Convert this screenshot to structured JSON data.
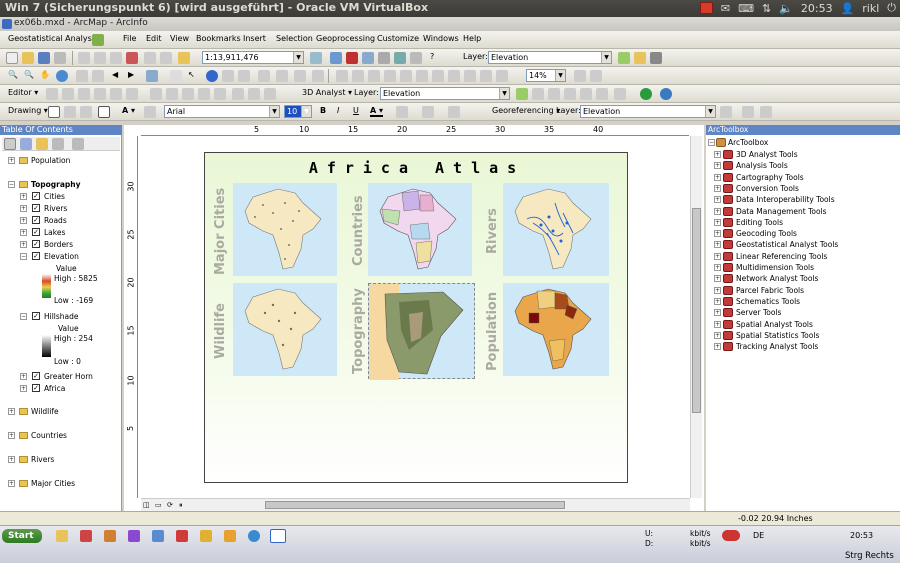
{
  "os_bar": {
    "title": "Win 7 (Sicherungspunkt 6) [wird ausgeführt] - Oracle VM VirtualBox",
    "time": "20:53",
    "user": "rikl"
  },
  "app": {
    "title": "ex06b.mxd - ArcMap - ArcInfo"
  },
  "menu": {
    "geostat": "Geostatistical Analyst ▾",
    "items": [
      "File",
      "Edit",
      "View",
      "Bookmarks",
      "Insert",
      "Selection",
      "Geoprocessing",
      "Customize",
      "Windows",
      "Help"
    ]
  },
  "toolbar1": {
    "scale": "1:13,911,476",
    "layer_label": "Layer:",
    "layer_value": "Elevation"
  },
  "toolbar2": {
    "zoom": "14%"
  },
  "toolbar3": {
    "editor": "Editor ▾",
    "analyst": "3D Analyst ▾",
    "layer_label": "Layer:",
    "layer_value": "Elevation"
  },
  "toolbar4": {
    "drawing": "Drawing ▾",
    "font": "Arial",
    "size": "10",
    "bold": "B",
    "italic": "I",
    "underline": "U",
    "georef": "Georeferencing ▾",
    "layer_label": "Layer:",
    "layer_value": "Elevation"
  },
  "toc": {
    "header": "Table Of Contents",
    "population": "Population",
    "topography": "Topography",
    "layers": [
      "Cities",
      "Rivers",
      "Roads",
      "Lakes",
      "Borders",
      "Elevation"
    ],
    "elev_value": "Value",
    "elev_high": "High : 5825",
    "elev_low": "Low : -169",
    "hillshade": "Hillshade",
    "hs_value": "Value",
    "hs_high": "High : 254",
    "hs_low": "Low : 0",
    "greater_horn": "Greater Horn",
    "africa": "Africa",
    "frames": [
      "Wildlife",
      "Countries",
      "Rivers",
      "Major Cities"
    ]
  },
  "map": {
    "title": "Africa  Atlas",
    "panels": [
      "Major Cities",
      "Countries",
      "Rivers",
      "Wildlife",
      "Topography",
      "Population"
    ],
    "ruler_top": [
      "5",
      "10",
      "15",
      "20",
      "25",
      "30",
      "35",
      "40"
    ],
    "ruler_left": [
      "30",
      "25",
      "20",
      "15",
      "10",
      "5"
    ]
  },
  "toolbox": {
    "header": "ArcToolbox",
    "root": "ArcToolbox",
    "items": [
      "3D Analyst Tools",
      "Analysis Tools",
      "Cartography Tools",
      "Conversion Tools",
      "Data Interoperability Tools",
      "Data Management Tools",
      "Editing Tools",
      "Geocoding Tools",
      "Geostatistical Analyst Tools",
      "Linear Referencing Tools",
      "Multidimension Tools",
      "Network Analyst Tools",
      "Parcel Fabric Tools",
      "Schematics Tools",
      "Server Tools",
      "Spatial Analyst Tools",
      "Spatial Statistics Tools",
      "Tracking Analyst Tools"
    ]
  },
  "status": {
    "coords": "-0.02  20.94 Inches"
  },
  "taskbar": {
    "start": "Start",
    "net_up": "U:",
    "net_down": "D:",
    "kbits1": "kbit/s",
    "kbits2": "kbit/s",
    "lang": "DE",
    "time": "20:53",
    "strg": "Strg Rechts"
  }
}
